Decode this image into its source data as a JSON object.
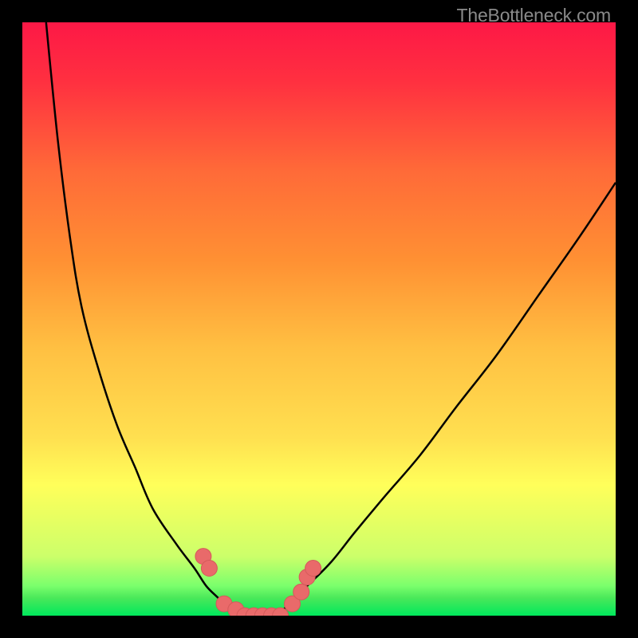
{
  "attribution": "TheBottleneck.com",
  "colors": {
    "frame": "#000000",
    "curve_stroke": "#000000",
    "marker_fill": "#e96a6a",
    "marker_stroke": "#d45a5a"
  },
  "chart_data": {
    "type": "line",
    "title": "",
    "xlabel": "",
    "ylabel": "",
    "xlim": [
      0,
      100
    ],
    "ylim": [
      0,
      100
    ],
    "note": "Axes are unlabeled in the image; x/y shown as 0–100 and values read as plotted heights (pixel-space).",
    "series": [
      {
        "name": "curve-left",
        "x": [
          4,
          6,
          8,
          10,
          13,
          16,
          19,
          22,
          26,
          29,
          31,
          33,
          35,
          37
        ],
        "values": [
          100,
          80,
          64,
          52,
          41,
          32,
          25,
          18,
          12,
          8,
          5,
          3,
          1,
          0
        ]
      },
      {
        "name": "valley-floor",
        "x": [
          37,
          38,
          39,
          40,
          41,
          42,
          43
        ],
        "values": [
          0,
          0,
          0,
          0,
          0,
          0,
          0
        ]
      },
      {
        "name": "curve-right",
        "x": [
          43,
          45,
          48,
          52,
          56,
          61,
          67,
          73,
          80,
          87,
          94,
          100
        ],
        "values": [
          0,
          2,
          5,
          9,
          14,
          20,
          27,
          35,
          44,
          54,
          64,
          73
        ]
      }
    ],
    "markers": [
      {
        "x": 30.5,
        "y": 10
      },
      {
        "x": 31.5,
        "y": 8
      },
      {
        "x": 34,
        "y": 2
      },
      {
        "x": 36,
        "y": 1
      },
      {
        "x": 37.5,
        "y": 0
      },
      {
        "x": 39,
        "y": 0
      },
      {
        "x": 40.5,
        "y": 0
      },
      {
        "x": 42,
        "y": 0
      },
      {
        "x": 43.5,
        "y": 0
      },
      {
        "x": 45.5,
        "y": 2
      },
      {
        "x": 47,
        "y": 4
      },
      {
        "x": 48,
        "y": 6.5
      },
      {
        "x": 49,
        "y": 8
      }
    ]
  }
}
